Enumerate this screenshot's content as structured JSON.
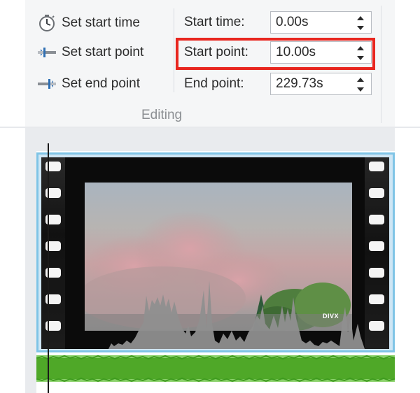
{
  "commands": {
    "set_start_time": {
      "label": "Set start time",
      "icon": "stopwatch-icon"
    },
    "set_start_point": {
      "label": "Set start point",
      "icon": "trim-start-icon"
    },
    "set_end_point": {
      "label": "Set end point",
      "icon": "trim-end-icon"
    }
  },
  "fields": {
    "start_time": {
      "label": "Start time:",
      "value": "0.00s"
    },
    "start_point": {
      "label": "Start point:",
      "value": "10.00s"
    },
    "end_point": {
      "label": "End point:",
      "value": "229.73s"
    }
  },
  "group_label": "Editing",
  "timeline": {
    "clip_badge": "DIVX"
  },
  "colors": {
    "highlight": "#e8261f",
    "clip_border": "#7fc4e6",
    "audio_track": "#8bd26b",
    "audio_wave": "#3e9b1e"
  }
}
